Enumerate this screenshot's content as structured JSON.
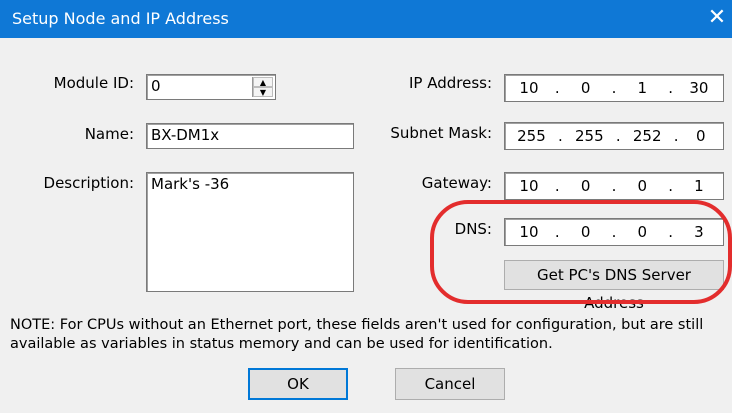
{
  "window": {
    "title": "Setup Node and IP Address",
    "close_glyph": "✕"
  },
  "form": {
    "module_id": {
      "label": "Module ID:",
      "value": "0"
    },
    "name": {
      "label": "Name:",
      "value": "BX-DM1x"
    },
    "description": {
      "label": "Description:",
      "value": "Mark's -36"
    },
    "ip_address": {
      "label": "IP Address:",
      "octets": [
        "10",
        "0",
        "1",
        "30"
      ]
    },
    "subnet_mask": {
      "label": "Subnet Mask:",
      "octets": [
        "255",
        "255",
        "252",
        "0"
      ]
    },
    "gateway": {
      "label": "Gateway:",
      "octets": [
        "10",
        "0",
        "0",
        "1"
      ]
    },
    "dns": {
      "label": "DNS:",
      "octets": [
        "10",
        "0",
        "0",
        "3"
      ]
    }
  },
  "buttons": {
    "get_dns": "Get PC's DNS Server Address",
    "ok": "OK",
    "cancel": "Cancel"
  },
  "note": "NOTE: For CPUs without an Ethernet port, these fields aren't used for configuration, but are still available as variables in status memory and can be used for identification.",
  "colors": {
    "titlebar": "#0f78d6",
    "annotation": "#e32d2d",
    "dialog_bg": "#f0f0f0"
  }
}
